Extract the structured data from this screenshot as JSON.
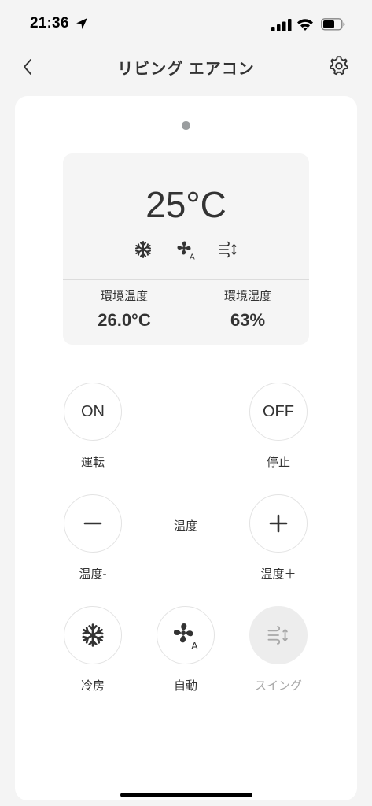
{
  "status_bar": {
    "time": "21:36"
  },
  "header": {
    "title": "リビング エアコン"
  },
  "display": {
    "set_temperature": "25°C",
    "icons": [
      "snowflake-icon",
      "fan-auto-icon",
      "swing-icon"
    ],
    "env_temp": {
      "label": "環境温度",
      "value": "26.0°C"
    },
    "env_humidity": {
      "label": "環境湿度",
      "value": "63%"
    }
  },
  "controls": {
    "on": {
      "button_text": "ON",
      "label": "運転"
    },
    "off": {
      "button_text": "OFF",
      "label": "停止"
    },
    "temp_down": {
      "label": "温度-"
    },
    "temp_center": {
      "label": "温度"
    },
    "temp_up": {
      "label": "温度＋"
    },
    "cool": {
      "label": "冷房"
    },
    "auto": {
      "label": "自動"
    },
    "swing": {
      "label": "スイング",
      "enabled": false
    }
  },
  "colors": {
    "background": "#f4f4f4",
    "card": "#ffffff",
    "display_panel": "#f5f5f5",
    "text": "#333333",
    "disabled_text": "#a8a8a8",
    "page_dot": "#9a9d9f"
  }
}
